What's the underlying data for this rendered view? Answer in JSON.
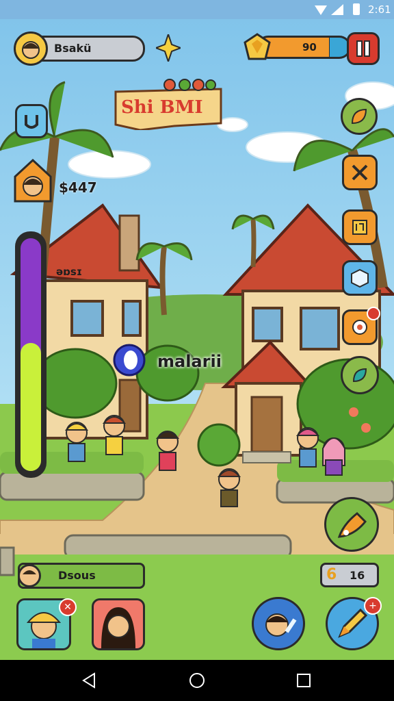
{
  "status_bar": {
    "time": "2:61"
  },
  "player": {
    "name": "Bsakü"
  },
  "energy": {
    "value": "90",
    "fill_fraction": 0.78
  },
  "title_banner": {
    "text": "Shi BMI"
  },
  "left_panel": {
    "money": "$447",
    "meter_label": "əɒsɪ",
    "meter_fill_fraction": 0.55
  },
  "center_label": {
    "ring_text": "O",
    "text": "malarii"
  },
  "bottom_name_bar": {
    "name": "Dsous"
  },
  "counter": {
    "left": "6",
    "right": "16"
  },
  "right_buttons": [
    "leaf-icon",
    "cross-icon",
    "card-icon",
    "cube-icon",
    "map-icon",
    "globe-icon"
  ],
  "colors": {
    "sky": "#9fd8f0",
    "grass": "#8cc94d",
    "path": "#e5c48a",
    "accent_orange": "#f29a2e",
    "pause_red": "#d83b2e"
  }
}
